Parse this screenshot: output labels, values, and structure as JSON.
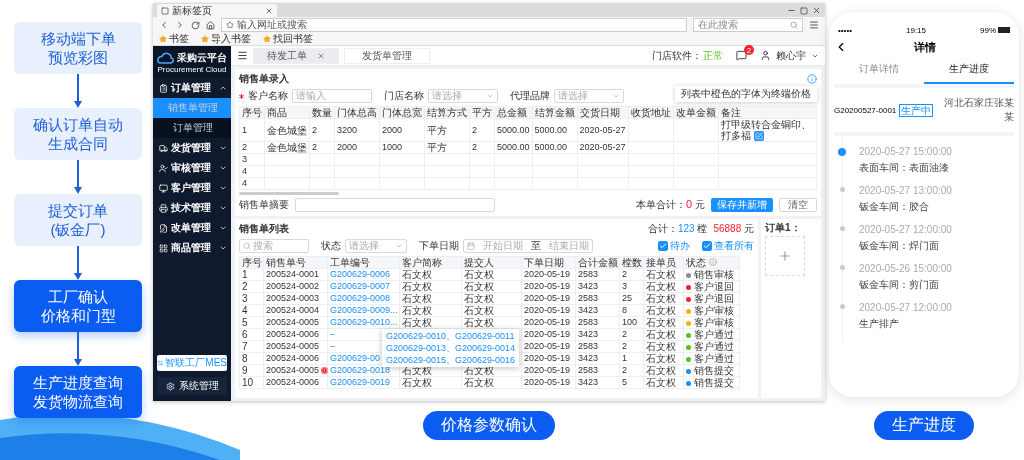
{
  "flow": {
    "steps": [
      {
        "lines": [
          "移动端下单",
          "预览彩图"
        ],
        "highlighted": false
      },
      {
        "lines": [
          "确认订单自动",
          "生成合同"
        ],
        "highlighted": false
      },
      {
        "lines": [
          "提交订单",
          "(钣金厂)"
        ],
        "highlighted": false
      },
      {
        "lines": [
          "工厂确认",
          "价格和门型"
        ],
        "highlighted": true
      },
      {
        "lines": [
          "生产进度查询",
          "发货物流查询"
        ],
        "highlighted": true
      }
    ]
  },
  "browser": {
    "tab_title": "新标签页",
    "address_placeholder": "输入网址或搜索",
    "search_placeholder": "在此搜索",
    "bookmarks": [
      "书签",
      "导入书签",
      "找回书签"
    ],
    "app": {
      "logo": {
        "name": "采购云平台",
        "subtitle": "Procurement Cloud"
      },
      "sidebar": {
        "items": [
          {
            "label": "订单管理",
            "expanded": true,
            "children": [
              {
                "label": "销售单管理",
                "selected": true
              },
              {
                "label": "订单管理",
                "selected": false
              }
            ]
          },
          {
            "label": "发货管理",
            "expanded": false
          },
          {
            "label": "审核管理",
            "expanded": false
          },
          {
            "label": "客户管理",
            "expanded": false
          },
          {
            "label": "技术管理",
            "expanded": false
          },
          {
            "label": "改单管理",
            "expanded": false
          },
          {
            "label": "商品管理",
            "expanded": false
          }
        ],
        "mes_button": "智联工厂MES",
        "settings_button": "系统管理"
      },
      "tabs": [
        {
          "label": "待发工单",
          "selected": true
        },
        {
          "label": "发货单管理",
          "selected": false
        }
      ],
      "header": {
        "status_label": "门店软件：",
        "status_value": "正常",
        "notification_count": "2",
        "user": "赖心宇"
      },
      "entry": {
        "title": "销售单录入",
        "tooltip": "列表中橙色的字体为终端价格",
        "fields": [
          {
            "label": "客户名称",
            "required": true,
            "placeholder": "请输入",
            "kind": "input"
          },
          {
            "label": "门店名称",
            "required": false,
            "placeholder": "请选择",
            "kind": "select"
          },
          {
            "label": "代理品牌",
            "required": false,
            "placeholder": "请选择",
            "kind": "select"
          }
        ],
        "columns": [
          "序号",
          "商品",
          "数量",
          "门体总高",
          "门体总宽",
          "结算方式",
          "平方",
          "总金额",
          "结算金额",
          "交货日期",
          "收货地址",
          "改单金额",
          "备注"
        ],
        "rows": [
          [
            "1",
            "金色城堡",
            "2",
            "3200",
            "2000",
            "平方",
            "2",
            "5000.00",
            "5000.00",
            "2020-05-27",
            "",
            "",
            "打甲级转合金铜印、打多福"
          ],
          [
            "2",
            "金色城堡",
            "2",
            "2000",
            "1000",
            "平方",
            "2",
            "5000.00",
            "5000.00",
            "2020-05-27",
            "",
            "",
            ""
          ],
          [
            "3",
            "",
            "",
            "",
            "",
            "",
            "",
            "",
            "",
            "",
            "",
            "",
            ""
          ],
          [
            "4",
            "",
            "",
            "",
            "",
            "",
            "",
            "",
            "",
            "",
            "",
            "",
            ""
          ],
          [
            "4",
            "",
            "",
            "",
            "",
            "",
            "",
            "",
            "",
            "",
            "",
            "",
            ""
          ]
        ],
        "summary_label": "销售单摘要",
        "total_label": "本单合计：",
        "total_value": "0",
        "total_unit": "元",
        "save_button": "保存并新增",
        "clear_button": "清空"
      },
      "list": {
        "title": "销售单列表",
        "total_label": "合计：",
        "total_count": "123",
        "count_unit": "樘",
        "total_amount": "56888",
        "amount_unit": "元",
        "search_placeholder": "搜索",
        "status_label": "状态",
        "status_placeholder": "请选择",
        "date_label": "下单日期",
        "date_start": "开始日期",
        "date_sep": "至",
        "date_end": "结束日期",
        "checks": [
          {
            "label": "待办",
            "checked": true
          },
          {
            "label": "查看所有",
            "checked": true
          }
        ],
        "columns": [
          "序号",
          "销售单号",
          "工单编号",
          "客户简称",
          "提交人",
          "下单日期",
          "合计金额",
          "樘数",
          "接单员",
          "状态"
        ],
        "rows": [
          {
            "cells": [
              "1",
              "200524-0001",
              "G200629-0006",
              "石文权",
              "石文权",
              "2020-05-19",
              "2583",
              "2",
              "石文权"
            ],
            "status": "销售审核",
            "color": "#8c8c8c",
            "alert": false
          },
          {
            "cells": [
              "2",
              "200524-0002",
              "G200629-0007",
              "石文权",
              "石文权",
              "2020-05-19",
              "3423",
              "3",
              "石文权"
            ],
            "status": "客户退回",
            "color": "#f5222d",
            "alert": false
          },
          {
            "cells": [
              "3",
              "200524-0003",
              "G200629-0008",
              "石文权",
              "石文权",
              "2020-05-19",
              "2583",
              "25",
              "石文权"
            ],
            "status": "客户退回",
            "color": "#f5222d",
            "alert": false
          },
          {
            "cells": [
              "4",
              "200524-0004",
              "G200629-0009...",
              "石文权",
              "石文权",
              "2020-05-19",
              "3423",
              "8",
              "石文权"
            ],
            "status": "客户审核",
            "color": "#faad14",
            "alert": false
          },
          {
            "cells": [
              "5",
              "200524-0005",
              "G200629-0010...",
              "石文权",
              "石文权",
              "2020-05-19",
              "2583",
              "100",
              "石文权"
            ],
            "status": "客户审核",
            "color": "#faad14",
            "alert": false
          },
          {
            "cells": [
              "6",
              "200524-0006",
              "–",
              "",
              "",
              "2020-05-19",
              "3423",
              "2",
              "石文权"
            ],
            "status": "客户通过",
            "color": "#52c41a",
            "alert": false
          },
          {
            "cells": [
              "7",
              "200524-0005",
              "–",
              "",
              "",
              "2020-05-19",
              "2583",
              "2",
              "石文权"
            ],
            "status": "客户通过",
            "color": "#52c41a",
            "alert": false
          },
          {
            "cells": [
              "8",
              "200524-0006",
              "G200629-00",
              "",
              "",
              "2020-05-19",
              "3423",
              "1",
              "石文权"
            ],
            "status": "客户通过",
            "color": "#52c41a",
            "alert": false
          },
          {
            "cells": [
              "9",
              "200524-0005",
              "G200629-0018",
              "石文权",
              "石文权",
              "2020-05-19",
              "2583",
              "2",
              "石文权"
            ],
            "status": "销售提交",
            "color": "#1890ff",
            "alert": true
          },
          {
            "cells": [
              "10",
              "200524-0006",
              "G200629-0019",
              "石文权",
              "石文权",
              "2020-05-19",
              "3423",
              "5",
              "石文权"
            ],
            "status": "销售提交",
            "color": "#1890ff",
            "alert": false
          }
        ],
        "popover": [
          "G200629-0010、G200629-0011",
          "G200629-0013、G200629-0014",
          "G200629-0015、G200629-0016"
        ]
      },
      "side_panel": {
        "title": "订单1："
      }
    },
    "caption": "价格参数确认"
  },
  "phone": {
    "carrier": "•••••",
    "time": "19:15",
    "battery": "99%",
    "title": "详情",
    "tabs": [
      {
        "label": "订单详情",
        "selected": false
      },
      {
        "label": "生产进度",
        "selected": true
      }
    ],
    "order": {
      "number": "G20200527-0001",
      "tag": "生产中",
      "customer": "河北石家庄张某某"
    },
    "timeline": [
      {
        "time": "2020-05-27 15:00:00",
        "text": "表面车间：表面油漆",
        "active": true
      },
      {
        "time": "2020-05-27 13:00:00",
        "text": "钣金车间：胶合",
        "active": false
      },
      {
        "time": "2020-05-27 12:00:00",
        "text": "钣金车间：焊门面",
        "active": false
      },
      {
        "time": "2020-05-26 15:00:00",
        "text": "钣金车间：剪门面",
        "active": false
      },
      {
        "time": "2020-05-27 12:00:00",
        "text": "生产排产",
        "active": false
      }
    ],
    "caption": "生产进度"
  }
}
